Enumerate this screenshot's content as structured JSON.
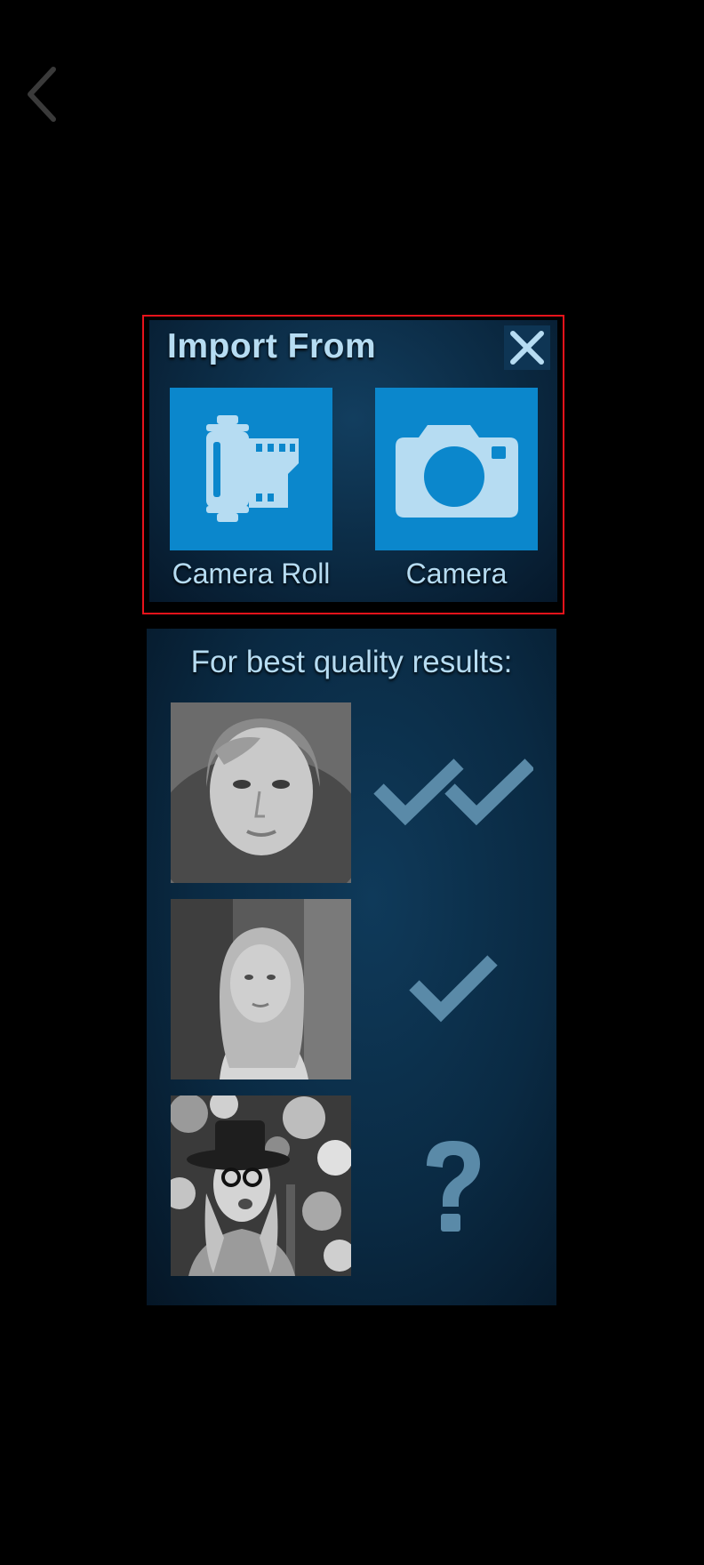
{
  "colors": {
    "background": "#000000",
    "panel": "#0b2a43",
    "tile": "#0b87cc",
    "text": "#b6dcf2",
    "mark": "#5a8aa8",
    "highlight": "#e8131b"
  },
  "nav": {
    "back_icon": "chevron-left-icon"
  },
  "import": {
    "title": "Import From",
    "close_icon": "close-icon",
    "sources": [
      {
        "label": "Camera Roll",
        "icon": "film-roll-icon"
      },
      {
        "label": "Camera",
        "icon": "camera-icon"
      }
    ]
  },
  "tips": {
    "heading": "For best quality results:",
    "items": [
      {
        "photo": "close-up portrait",
        "rating": "double check",
        "icon": "double-check-icon"
      },
      {
        "photo": "mid-distance portrait",
        "rating": "single check",
        "icon": "check-icon"
      },
      {
        "photo": "busy background portrait",
        "rating": "?",
        "icon": "question-icon"
      }
    ]
  }
}
